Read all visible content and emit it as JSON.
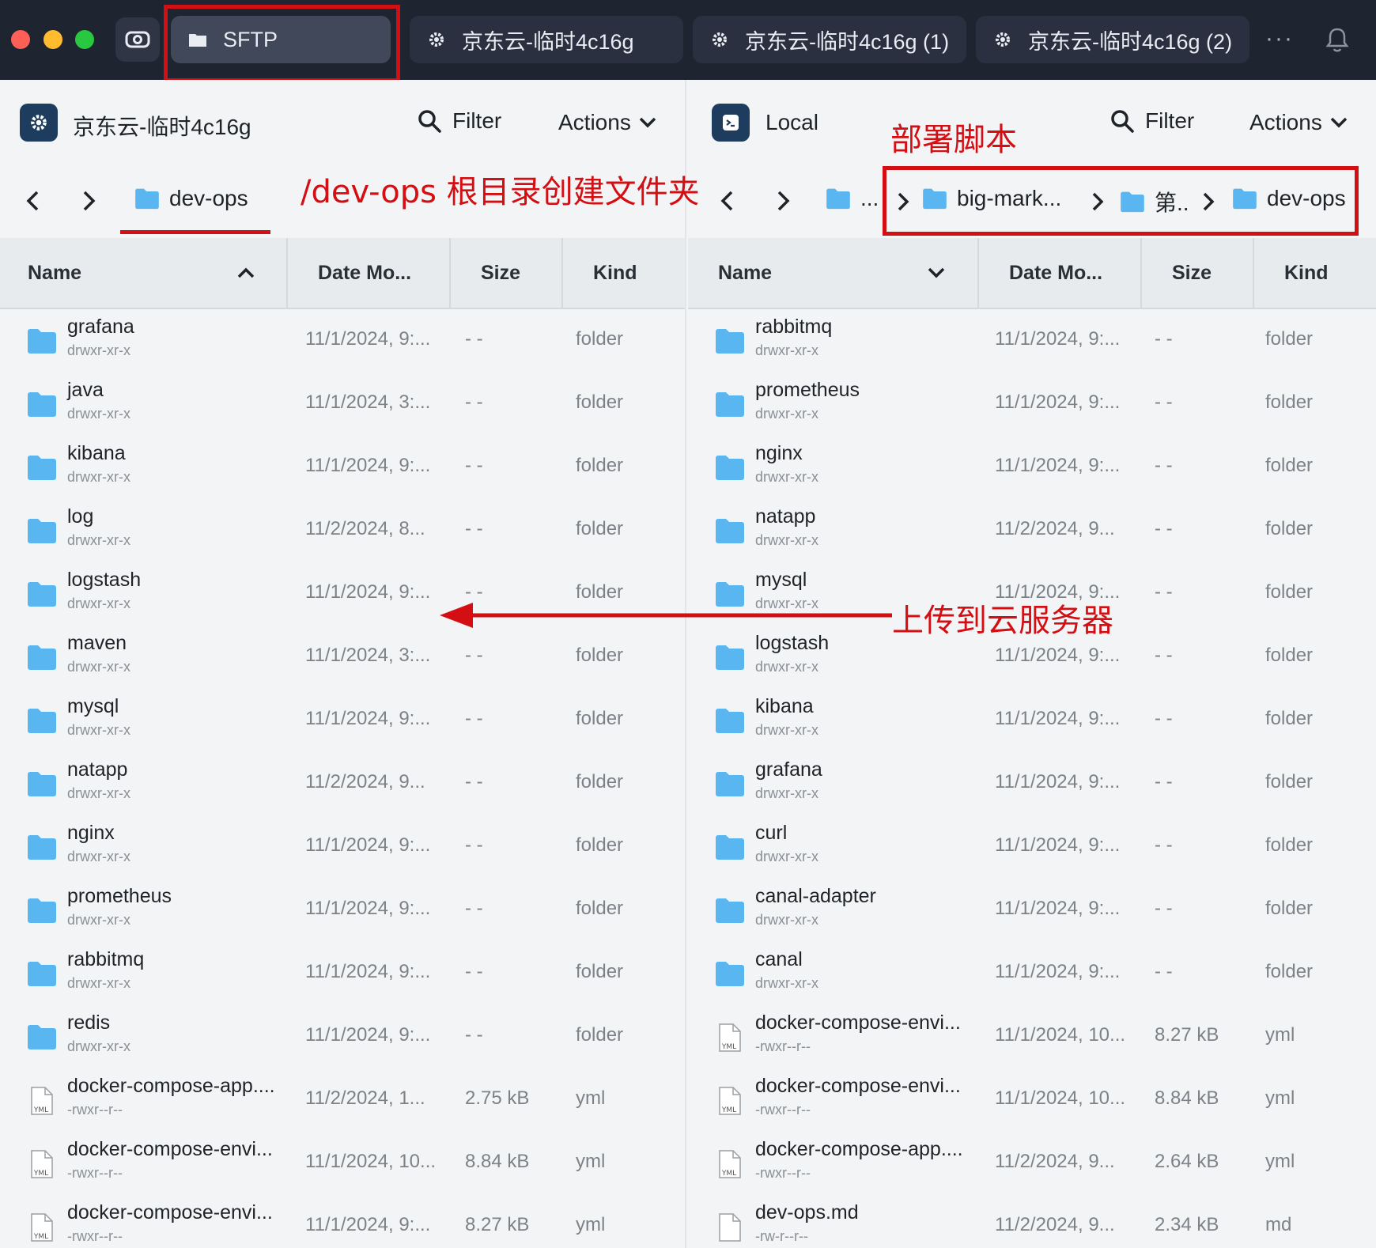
{
  "tabs": [
    {
      "label": "SFTP",
      "icon": "folder-icon",
      "active": true
    },
    {
      "label": "京东云-临时4c16g",
      "icon": "gear-icon"
    },
    {
      "label": "京东云-临时4c16g (1)",
      "icon": "gear-icon"
    },
    {
      "label": "京东云-临时4c16g (2)",
      "icon": "gear-icon"
    }
  ],
  "more_label": "···",
  "left": {
    "host": "京东云-临时4c16g",
    "filter": "Filter",
    "actions": "Actions",
    "breadcrumb": [
      "dev-ops"
    ],
    "columns": {
      "name": "Name",
      "date": "Date Mo...",
      "size": "Size",
      "kind": "Kind"
    },
    "rows": [
      {
        "name": "grafana",
        "perm": "drwxr-xr-x",
        "date": "11/1/2024, 9:...",
        "size": "- -",
        "kind": "folder",
        "type": "folder"
      },
      {
        "name": "java",
        "perm": "drwxr-xr-x",
        "date": "11/1/2024, 3:...",
        "size": "- -",
        "kind": "folder",
        "type": "folder"
      },
      {
        "name": "kibana",
        "perm": "drwxr-xr-x",
        "date": "11/1/2024, 9:...",
        "size": "- -",
        "kind": "folder",
        "type": "folder"
      },
      {
        "name": "log",
        "perm": "drwxr-xr-x",
        "date": "11/2/2024, 8...",
        "size": "- -",
        "kind": "folder",
        "type": "folder"
      },
      {
        "name": "logstash",
        "perm": "drwxr-xr-x",
        "date": "11/1/2024, 9:...",
        "size": "- -",
        "kind": "folder",
        "type": "folder"
      },
      {
        "name": "maven",
        "perm": "drwxr-xr-x",
        "date": "11/1/2024, 3:...",
        "size": "- -",
        "kind": "folder",
        "type": "folder"
      },
      {
        "name": "mysql",
        "perm": "drwxr-xr-x",
        "date": "11/1/2024, 9:...",
        "size": "- -",
        "kind": "folder",
        "type": "folder"
      },
      {
        "name": "natapp",
        "perm": "drwxr-xr-x",
        "date": "11/2/2024, 9...",
        "size": "- -",
        "kind": "folder",
        "type": "folder"
      },
      {
        "name": "nginx",
        "perm": "drwxr-xr-x",
        "date": "11/1/2024, 9:...",
        "size": "- -",
        "kind": "folder",
        "type": "folder"
      },
      {
        "name": "prometheus",
        "perm": "drwxr-xr-x",
        "date": "11/1/2024, 9:...",
        "size": "- -",
        "kind": "folder",
        "type": "folder"
      },
      {
        "name": "rabbitmq",
        "perm": "drwxr-xr-x",
        "date": "11/1/2024, 9:...",
        "size": "- -",
        "kind": "folder",
        "type": "folder"
      },
      {
        "name": "redis",
        "perm": "drwxr-xr-x",
        "date": "11/1/2024, 9:...",
        "size": "- -",
        "kind": "folder",
        "type": "folder"
      },
      {
        "name": "docker-compose-app....",
        "perm": "-rwxr--r--",
        "date": "11/2/2024, 1...",
        "size": "2.75 kB",
        "kind": "yml",
        "type": "yml"
      },
      {
        "name": "docker-compose-envi...",
        "perm": "-rwxr--r--",
        "date": "11/1/2024, 10...",
        "size": "8.84 kB",
        "kind": "yml",
        "type": "yml"
      },
      {
        "name": "docker-compose-envi...",
        "perm": "-rwxr--r--",
        "date": "11/1/2024, 9:...",
        "size": "8.27 kB",
        "kind": "yml",
        "type": "yml"
      }
    ]
  },
  "right": {
    "host": "Local",
    "filter": "Filter",
    "actions": "Actions",
    "breadcrumb": [
      "...",
      "big-mark...",
      "第..",
      "dev-ops"
    ],
    "columns": {
      "name": "Name",
      "date": "Date Mo...",
      "size": "Size",
      "kind": "Kind"
    },
    "rows": [
      {
        "name": "rabbitmq",
        "perm": "drwxr-xr-x",
        "date": "11/1/2024, 9:...",
        "size": "- -",
        "kind": "folder",
        "type": "folder"
      },
      {
        "name": "prometheus",
        "perm": "drwxr-xr-x",
        "date": "11/1/2024, 9:...",
        "size": "- -",
        "kind": "folder",
        "type": "folder"
      },
      {
        "name": "nginx",
        "perm": "drwxr-xr-x",
        "date": "11/1/2024, 9:...",
        "size": "- -",
        "kind": "folder",
        "type": "folder"
      },
      {
        "name": "natapp",
        "perm": "drwxr-xr-x",
        "date": "11/2/2024, 9...",
        "size": "- -",
        "kind": "folder",
        "type": "folder"
      },
      {
        "name": "mysql",
        "perm": "drwxr-xr-x",
        "date": "11/1/2024, 9:...",
        "size": "- -",
        "kind": "folder",
        "type": "folder"
      },
      {
        "name": "logstash",
        "perm": "drwxr-xr-x",
        "date": "11/1/2024, 9:...",
        "size": "- -",
        "kind": "folder",
        "type": "folder"
      },
      {
        "name": "kibana",
        "perm": "drwxr-xr-x",
        "date": "11/1/2024, 9:...",
        "size": "- -",
        "kind": "folder",
        "type": "folder"
      },
      {
        "name": "grafana",
        "perm": "drwxr-xr-x",
        "date": "11/1/2024, 9:...",
        "size": "- -",
        "kind": "folder",
        "type": "folder"
      },
      {
        "name": "curl",
        "perm": "drwxr-xr-x",
        "date": "11/1/2024, 9:...",
        "size": "- -",
        "kind": "folder",
        "type": "folder"
      },
      {
        "name": "canal-adapter",
        "perm": "drwxr-xr-x",
        "date": "11/1/2024, 9:...",
        "size": "- -",
        "kind": "folder",
        "type": "folder"
      },
      {
        "name": "canal",
        "perm": "drwxr-xr-x",
        "date": "11/1/2024, 9:...",
        "size": "- -",
        "kind": "folder",
        "type": "folder"
      },
      {
        "name": "docker-compose-envi...",
        "perm": "-rwxr--r--",
        "date": "11/1/2024, 10...",
        "size": "8.27 kB",
        "kind": "yml",
        "type": "yml"
      },
      {
        "name": "docker-compose-envi...",
        "perm": "-rwxr--r--",
        "date": "11/1/2024, 10...",
        "size": "8.84 kB",
        "kind": "yml",
        "type": "yml"
      },
      {
        "name": "docker-compose-app....",
        "perm": "-rwxr--r--",
        "date": "11/2/2024, 9...",
        "size": "2.64 kB",
        "kind": "yml",
        "type": "yml"
      },
      {
        "name": "dev-ops.md",
        "perm": "-rw-r--r--",
        "date": "11/2/2024, 9...",
        "size": "2.34 kB",
        "kind": "md",
        "type": "md"
      }
    ]
  },
  "annotations": {
    "mkdir": "/dev-ops 根目录创建文件夹",
    "deploy": "部署脚本",
    "upload": "上传到云服务器",
    "color": "#d40f14"
  },
  "colors": {
    "titlebar": "#1f2431",
    "folder": "#5ab6f0",
    "accent_red": "#d40f14"
  }
}
